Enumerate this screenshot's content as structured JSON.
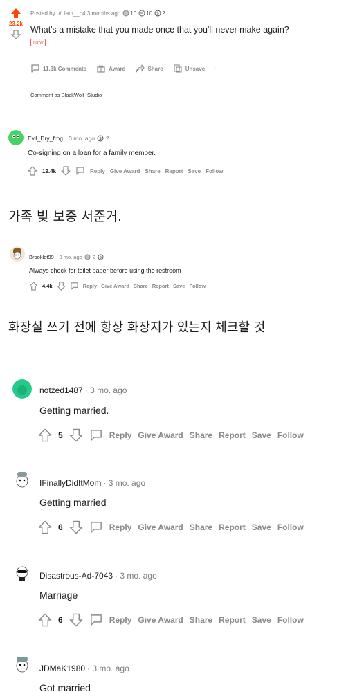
{
  "post": {
    "meta_prefix": "Posted by u/Llam__b4 3 months ago",
    "award_count_1": "10",
    "award_count_2": "10",
    "award_count_3": "2",
    "score": "23.2k",
    "title": "What's a mistake that you made once that you'll never make again?",
    "tag": "nsfw",
    "actions": {
      "comments": "11.3k Comments",
      "award": "Award",
      "share": "Share",
      "save": "Unsave",
      "more": "···"
    },
    "comment_as": "Comment as BlackWolf_Studio"
  },
  "comments": [
    {
      "user": "Evil_Dry_frog",
      "ago": "· 3 mo. ago",
      "award_count": "2",
      "body": "Co-signing on a loan for a family member.",
      "votes": "19.4k",
      "avatar_color": "#46d160"
    },
    {
      "user": "Brooklet99",
      "ago": "· 3 mo. ago",
      "award_count": "2",
      "body": "Always check for toilet paper before using the restroom",
      "votes": "4.4k",
      "avatar_color": "#8b5a2b"
    },
    {
      "user": "notzed1487",
      "ago": "· 3 mo. ago",
      "body": "Getting married.",
      "votes": "5",
      "avatar_color": "#24c98c"
    },
    {
      "user": "IFinallyDidItMom",
      "ago": "· 3 mo. ago",
      "body": "Getting married",
      "votes": "6",
      "avatar_color": "#8a9a9a"
    },
    {
      "user": "Disastrous-Ad-7043",
      "ago": "· 3 mo. ago",
      "body": "Marriage",
      "votes": "6",
      "avatar_color": "#dddddd"
    },
    {
      "user": "JDMaK1980",
      "ago": "· 3 mo. ago",
      "body": "Got married",
      "avatar_color": "#7a9a9a"
    }
  ],
  "comment_actions": {
    "reply": "Reply",
    "give_award": "Give Award",
    "share": "Share",
    "report": "Report",
    "save": "Save",
    "follow": "Follow"
  },
  "captions": {
    "first": "가족 빚 보증 서준거.",
    "second": "화장실 쓰기 전에 항상 화장지가 있는지 체크할 것"
  },
  "colors": {
    "upvote": "#ff4500",
    "nsfw": "#ff585b",
    "muted": "#878a8c"
  }
}
